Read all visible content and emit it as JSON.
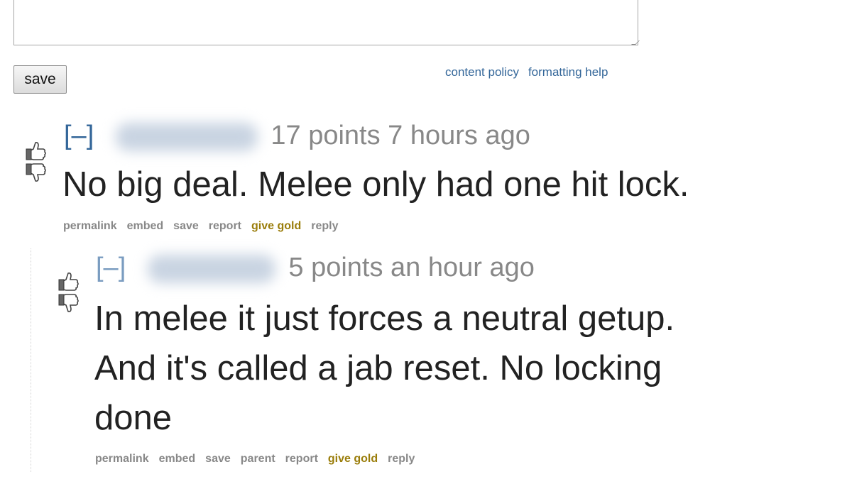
{
  "editor": {
    "textarea_value": "",
    "save_label": "save",
    "content_policy_label": "content policy",
    "formatting_help_label": "formatting help"
  },
  "comments": [
    {
      "toggle": "[–]",
      "score": "17 points",
      "time": "7 hours ago",
      "body_lines": [
        "No big deal. Melee only had one hit lock."
      ],
      "actions": {
        "permalink": "permalink",
        "embed": "embed",
        "save": "save",
        "report": "report",
        "give_gold": "give gold",
        "reply": "reply"
      }
    },
    {
      "toggle": "[–]",
      "score": "5 points",
      "time": "an hour ago",
      "body_lines": [
        "In melee it just forces a neutral getup.",
        "And it's called a jab reset. No locking",
        "done"
      ],
      "actions": {
        "permalink": "permalink",
        "embed": "embed",
        "save": "save",
        "parent": "parent",
        "report": "report",
        "give_gold": "give gold",
        "reply": "reply"
      }
    }
  ],
  "colors": {
    "link_blue": "#336699",
    "tagline_gray": "#888888",
    "gold": "#9a7d0a",
    "body_text": "#222222"
  },
  "icons": {
    "upvote": "thumbs-up-icon",
    "downvote": "thumbs-down-icon"
  }
}
